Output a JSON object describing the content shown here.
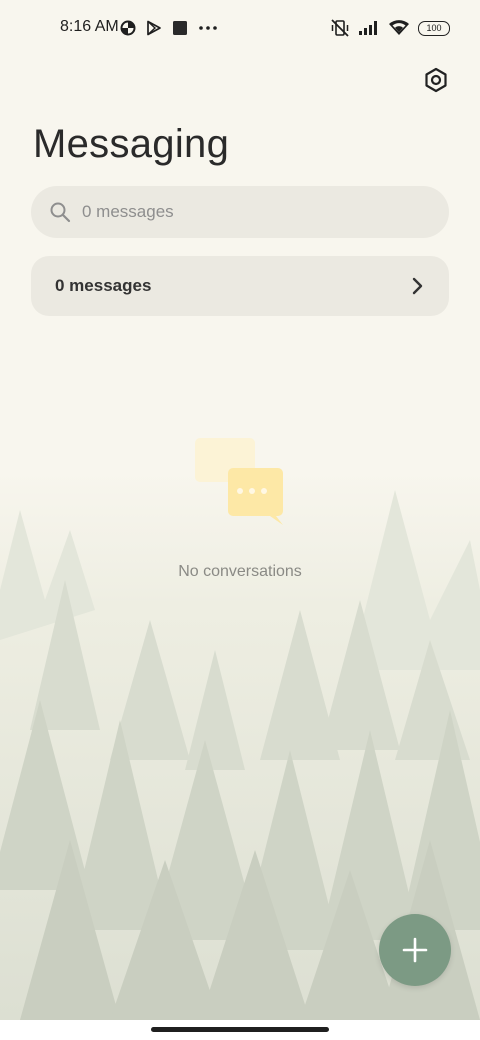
{
  "status_bar": {
    "time": "8:16 AM",
    "battery": "100",
    "left_icons": [
      "data-saver-icon",
      "play-store-icon",
      "stop-square-icon",
      "more-dots-icon"
    ],
    "right_icons": [
      "vibrate-off-icon",
      "signal-icon",
      "wifi-icon",
      "battery-icon"
    ]
  },
  "header": {
    "title": "Messaging",
    "settings_icon": "settings-hex-icon"
  },
  "search": {
    "placeholder": "0 messages"
  },
  "folder": {
    "label": "0 messages"
  },
  "empty_state": {
    "text": "No conversations",
    "icon": "chat-bubbles-icon"
  },
  "fab": {
    "icon": "plus-icon",
    "color": "#7c9a84"
  },
  "colors": {
    "background": "#f8f6ee",
    "surface": "#ebe9e1",
    "accent": "#7c9a84",
    "empty_icon": "#fde8a6"
  }
}
